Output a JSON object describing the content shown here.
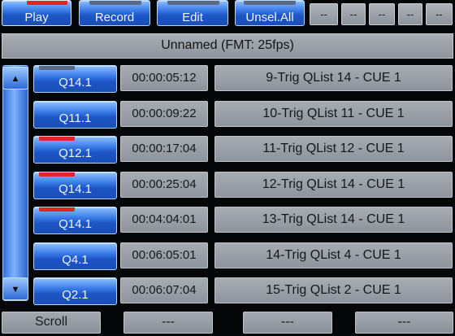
{
  "toolbar": {
    "play": "Play",
    "record": "Record",
    "edit": "Edit",
    "unsel_all": "Unsel.All",
    "placeholders": [
      "--",
      "--",
      "--",
      "--",
      "--"
    ]
  },
  "status": "Unnamed (FMT: 25fps)",
  "cues": [
    {
      "q": "Q14.1",
      "time": "00:00:05:12",
      "name": "9-Trig QList 14 - CUE 1",
      "flag": "dark"
    },
    {
      "q": "Q11.1",
      "time": "00:00:09:22",
      "name": "10-Trig QList 11 - CUE 1",
      "flag": "none"
    },
    {
      "q": "Q12.1",
      "time": "00:00:17:04",
      "name": "11-Trig QList 12 - CUE 1",
      "flag": "red"
    },
    {
      "q": "Q14.1",
      "time": "00:00:25:04",
      "name": "12-Trig QList 14 - CUE 1",
      "flag": "red"
    },
    {
      "q": "Q14.1",
      "time": "00:04:04:01",
      "name": "13-Trig QList 14 - CUE 1",
      "flag": "red"
    },
    {
      "q": "Q4.1",
      "time": "00:06:05:01",
      "name": "14-Trig QList 4 - CUE 1",
      "flag": "none"
    },
    {
      "q": "Q2.1",
      "time": "00:06:07:04",
      "name": "15-Trig QList 2 - CUE 1",
      "flag": "none"
    }
  ],
  "scroll": {
    "up_icon": "triangle-up",
    "down_icon": "triangle-down"
  },
  "bottom": {
    "scroll": "Scroll",
    "placeholders": [
      "---",
      "---",
      "---"
    ]
  },
  "colors": {
    "accent_blue": "#2a66d8",
    "flag_red": "#e3232a",
    "panel_gray": "#9aa0a8"
  }
}
